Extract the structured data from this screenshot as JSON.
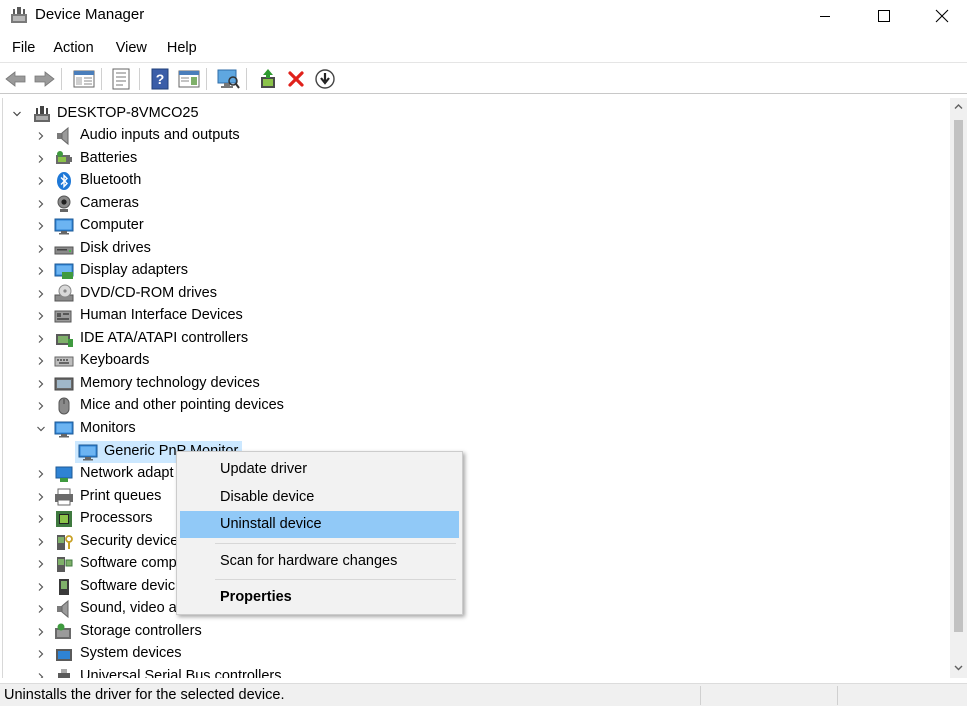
{
  "window": {
    "title": "Device Manager",
    "controls": [
      "minimize",
      "maximize",
      "close"
    ]
  },
  "menubar": [
    {
      "label": "File"
    },
    {
      "label": "Action"
    },
    {
      "label": "View"
    },
    {
      "label": "Help"
    }
  ],
  "toolbar": [
    "back-icon",
    "forward-icon",
    "show-hide-console-tree-icon",
    "properties-icon",
    "help-icon",
    "action-pane-icon",
    "scan-hardware-icon",
    "update-driver-icon",
    "uninstall-device-icon",
    "enable-device-icon"
  ],
  "tree": {
    "root": "DESKTOP-8VMCO25",
    "categories": [
      {
        "label": "Audio inputs and outputs",
        "icon": "speaker-icon"
      },
      {
        "label": "Batteries",
        "icon": "battery-icon"
      },
      {
        "label": "Bluetooth",
        "icon": "bluetooth-icon"
      },
      {
        "label": "Cameras",
        "icon": "camera-icon"
      },
      {
        "label": "Computer",
        "icon": "computer-icon"
      },
      {
        "label": "Disk drives",
        "icon": "disk-drive-icon"
      },
      {
        "label": "Display adapters",
        "icon": "display-adapter-icon"
      },
      {
        "label": "DVD/CD-ROM drives",
        "icon": "dvd-drive-icon"
      },
      {
        "label": "Human Interface Devices",
        "icon": "hid-icon"
      },
      {
        "label": "IDE ATA/ATAPI controllers",
        "icon": "ide-controller-icon"
      },
      {
        "label": "Keyboards",
        "icon": "keyboard-icon"
      },
      {
        "label": "Memory technology devices",
        "icon": "memory-icon"
      },
      {
        "label": "Mice and other pointing devices",
        "icon": "mouse-icon"
      },
      {
        "label": "Monitors",
        "icon": "monitor-icon",
        "expanded": true
      },
      {
        "label": "Network adapt",
        "icon": "network-adapter-icon"
      },
      {
        "label": "Print queues",
        "icon": "printer-icon"
      },
      {
        "label": "Processors",
        "icon": "processor-icon"
      },
      {
        "label": "Security device",
        "icon": "security-device-icon"
      },
      {
        "label": "Software comp",
        "icon": "software-component-icon"
      },
      {
        "label": "Software devic",
        "icon": "software-device-icon"
      },
      {
        "label": "Sound, video a",
        "icon": "sound-video-icon"
      },
      {
        "label": "Storage controllers",
        "icon": "storage-controller-icon"
      },
      {
        "label": "System devices",
        "icon": "system-devices-icon"
      },
      {
        "label": "Universal Serial Bus controllers",
        "icon": "usb-icon"
      }
    ],
    "monitor_child": "Generic PnP Monitor"
  },
  "context_menu": {
    "items": [
      {
        "label": "Update driver"
      },
      {
        "label": "Disable device"
      },
      {
        "label": "Uninstall device",
        "highlighted": true
      },
      {
        "label": "Scan for hardware changes"
      },
      {
        "label": "Properties",
        "bold": true
      }
    ]
  },
  "status": {
    "text": "Uninstalls the driver for the selected device."
  },
  "colors": {
    "selection": "#cce8ff",
    "menu_highlight": "#91c9f7",
    "uninstall_red": "#e0211b"
  }
}
